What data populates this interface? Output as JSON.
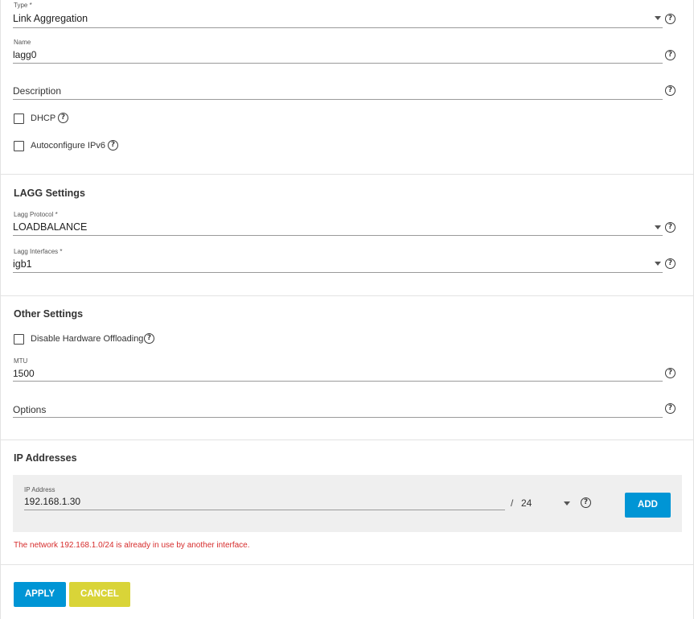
{
  "form": {
    "type": {
      "label": "Type *",
      "value": "Link Aggregation"
    },
    "name": {
      "label": "Name",
      "value": "lagg0"
    },
    "description": {
      "placeholder": "Description"
    },
    "dhcp": {
      "label": "DHCP",
      "checked": false
    },
    "autoconfigure_ipv6": {
      "label": "Autoconfigure IPv6",
      "checked": false
    }
  },
  "lagg": {
    "title": "LAGG Settings",
    "protocol": {
      "label": "Lagg Protocol *",
      "value": "LOADBALANCE"
    },
    "interfaces": {
      "label": "Lagg Interfaces *",
      "value": "igb1"
    }
  },
  "other": {
    "title": "Other Settings",
    "disable_hw_offloading": {
      "label": "Disable Hardware Offloading",
      "checked": false
    },
    "mtu": {
      "label": "MTU",
      "value": "1500"
    },
    "options": {
      "placeholder": "Options"
    }
  },
  "ip": {
    "title": "IP Addresses",
    "address": {
      "label": "IP Address",
      "value": "192.168.1.30"
    },
    "separator": "/",
    "netmask": "24",
    "add_label": "ADD",
    "error": "The network 192.168.1.0/24 is already in use by another interface."
  },
  "actions": {
    "apply_label": "APPLY",
    "cancel_label": "CANCEL"
  },
  "colors": {
    "primary": "#0095d5",
    "warning": "#d9d438",
    "error": "#d62c2c"
  }
}
